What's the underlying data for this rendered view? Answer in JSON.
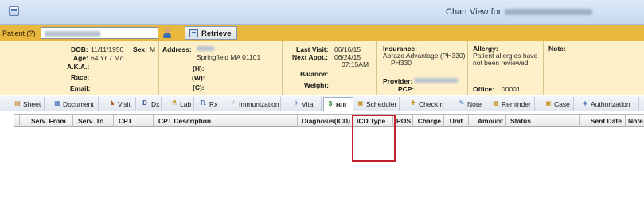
{
  "window": {
    "title": "Chart View for"
  },
  "patient_bar": {
    "label": "Patient (?)",
    "retrieve_label": "Retrieve"
  },
  "demographics": {
    "dob_label": "DOB:",
    "dob": "11/11/1950",
    "sex_label": "Sex:",
    "sex": "M",
    "age_label": "Age:",
    "age": "64 Yr 7 Mo",
    "aka_label": "A.K.A.:",
    "race_label": "Race:",
    "email_label": "Email:"
  },
  "address": {
    "label": "Address:",
    "city": "Springfield  MA  01101",
    "home_label": "(H):",
    "work_label": "(W):",
    "cell_label": "(C):"
  },
  "visits": {
    "last_visit_label": "Last Visit:",
    "last_visit": "06/16/15",
    "next_appt_label": "Next Appt.:",
    "next_appt": "06/24/15",
    "next_appt_time": "07:15AM",
    "balance_label": "Balance:",
    "weight_label": "Weight:"
  },
  "insurance": {
    "label": "Insurance:",
    "plan": "Abrazo Advantage  (PH330)",
    "plan_code": "PH330",
    "provider_label": "Provider:",
    "pcp_label": "PCP:"
  },
  "allergy": {
    "label": "Allergy:",
    "text_line1": "Patient allergies have",
    "text_line2": "not been reviewed.",
    "office_label": "Office:",
    "office": "00001"
  },
  "note": {
    "label": "Note:"
  },
  "toolbar": {
    "items": [
      {
        "label": "Sheet",
        "icon": "sheet-icon"
      },
      {
        "label": "Document",
        "icon": "document-icon"
      },
      {
        "label": "Visit",
        "icon": "visit-icon"
      },
      {
        "label": "Dx",
        "icon": "dx-icon"
      },
      {
        "label": "Lab",
        "icon": "lab-icon"
      },
      {
        "label": "Rx",
        "icon": "rx-icon"
      },
      {
        "label": "Immunization",
        "icon": "immunization-icon"
      },
      {
        "label": "Vital",
        "icon": "vital-icon"
      },
      {
        "label": "Bill",
        "icon": "bill-icon",
        "active": true
      },
      {
        "label": "Scheduler",
        "icon": "scheduler-icon"
      },
      {
        "label": "CheckIn",
        "icon": "checkin-icon"
      },
      {
        "label": "Note",
        "icon": "note-icon"
      },
      {
        "label": "Reminder",
        "icon": "reminder-icon"
      },
      {
        "label": "Case",
        "icon": "case-icon"
      },
      {
        "label": "Authorization",
        "icon": "authorization-icon"
      }
    ]
  },
  "grid": {
    "columns": [
      "Serv. From",
      "Serv. To",
      "CPT",
      "CPT Description",
      "Diagnosis(ICD)",
      "ICD Type",
      "POS",
      "Charge",
      "Unit",
      "Amount",
      "Status",
      "Sent Date",
      "Note"
    ],
    "rows": []
  },
  "colors": {
    "patient_bar": "#e8b73d",
    "info_panel": "#fdf0c8",
    "highlight": "#c0232b"
  }
}
